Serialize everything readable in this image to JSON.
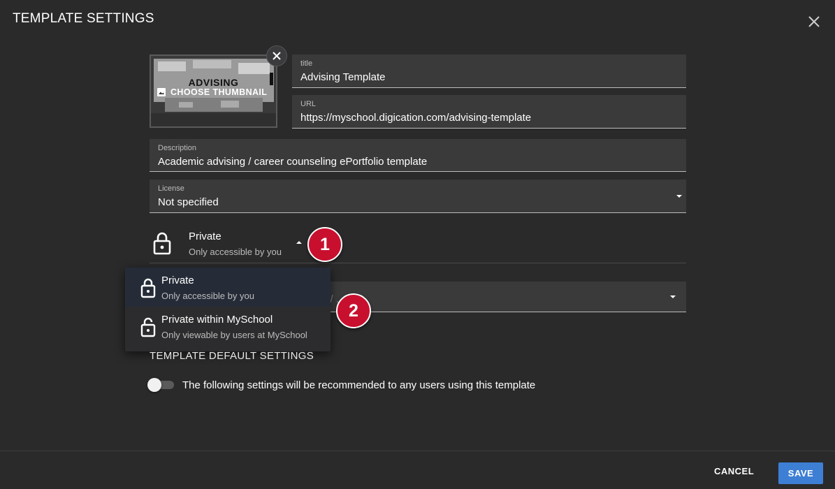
{
  "dialog": {
    "title": "TEMPLATE SETTINGS"
  },
  "thumbnail": {
    "image_text": "ADVISING",
    "choose_label": "CHOOSE THUMBNAIL"
  },
  "fields": {
    "title": {
      "label": "title",
      "value": "Advising Template"
    },
    "url": {
      "label": "URL",
      "value": "https://myschool.digication.com/advising-template"
    },
    "description": {
      "label": "Description",
      "value": "Academic advising / career counseling ePortfolio template"
    },
    "license": {
      "label": "License",
      "value": "Not specified"
    }
  },
  "privacy": {
    "selected_title": "Private",
    "selected_subtitle": "Only accessible by you",
    "behind_placeholder": "p / ... se"
  },
  "menu": {
    "items": [
      {
        "title": "Private",
        "subtitle": "Only accessible by you",
        "selected": true
      },
      {
        "title": "Private within MySchool",
        "subtitle": "Only viewable by users at MySchool",
        "selected": false
      }
    ]
  },
  "badges": [
    "1",
    "2"
  ],
  "defaults": {
    "section_title": "TEMPLATE DEFAULT SETTINGS",
    "toggle_label": "The following settings will be recommended to any users using this template",
    "toggle_on": false
  },
  "footer": {
    "cancel_label": "CANCEL",
    "save_label": "SAVE"
  },
  "colors": {
    "background": "#2a2a2b",
    "field": "#3a3a3b",
    "accent": "#3d7fd4",
    "badge": "#c8102e"
  }
}
